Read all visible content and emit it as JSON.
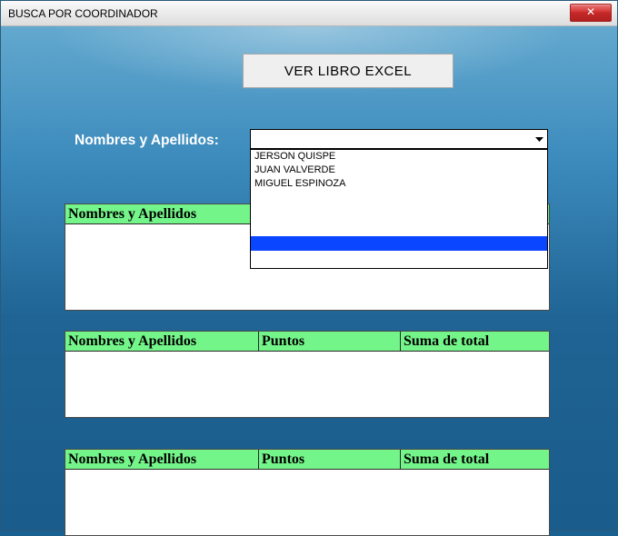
{
  "window": {
    "title": "BUSCA POR COORDINADOR"
  },
  "buttons": {
    "ver_libro": "VER LIBRO EXCEL",
    "close_glyph": "✕"
  },
  "search": {
    "label": "Nombres y Apellidos:",
    "value": "",
    "placeholder": ""
  },
  "dropdown": {
    "options": [
      "JERSON QUISPE",
      "JUAN VALVERDE",
      "MIGUEL ESPINOZA"
    ]
  },
  "tables": {
    "t1": {
      "headers": [
        "Nombres y Apellidos"
      ]
    },
    "t2": {
      "headers": [
        "Nombres y Apellidos",
        "Puntos",
        "Suma de total"
      ]
    },
    "t3": {
      "headers": [
        "Nombres y Apellidos",
        "Puntos",
        "Suma de total"
      ]
    }
  }
}
